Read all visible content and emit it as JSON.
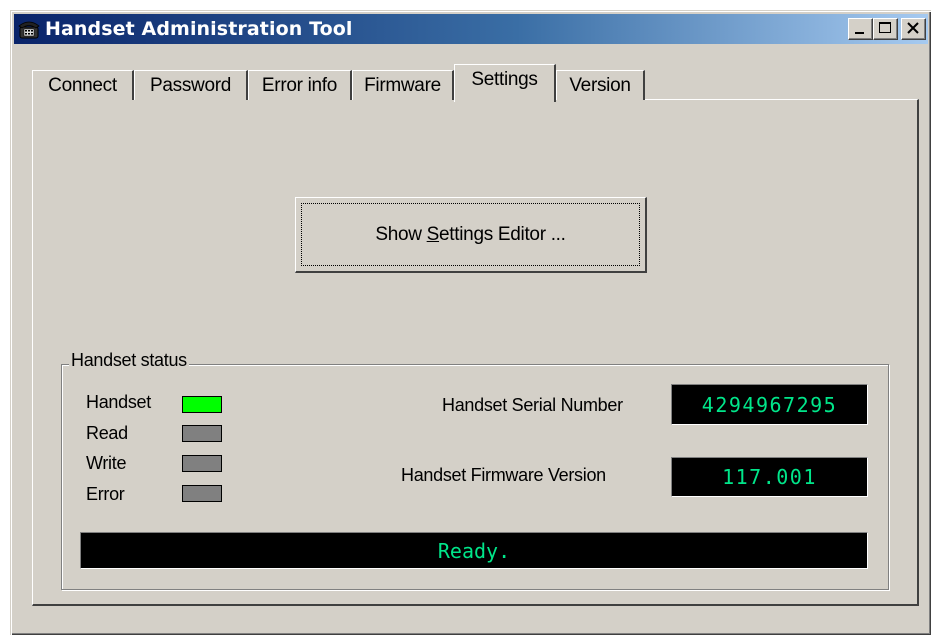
{
  "window": {
    "title": "Handset Administration Tool",
    "icon": "phone-icon",
    "controls": [
      "minimize-icon",
      "maximize-icon",
      "close-icon"
    ]
  },
  "tabs": [
    {
      "label": "Connect",
      "active": false
    },
    {
      "label": "Password",
      "active": false
    },
    {
      "label": "Error info",
      "active": false
    },
    {
      "label": "Firmware",
      "active": false
    },
    {
      "label": "Settings",
      "active": true
    },
    {
      "label": "Version",
      "active": false
    }
  ],
  "settings": {
    "editor_button_prefix": "Show ",
    "editor_button_mnemonic": "S",
    "editor_button_suffix": "ettings Editor ..."
  },
  "status": {
    "group_title": "Handset status",
    "indicators": [
      {
        "label": "Handset",
        "state": "on",
        "color": "#00ff00"
      },
      {
        "label": "Read",
        "state": "off",
        "color": "#808080"
      },
      {
        "label": "Write",
        "state": "off",
        "color": "#808080"
      },
      {
        "label": "Error",
        "state": "off",
        "color": "#808080"
      }
    ],
    "serial_label": "Handset Serial Number",
    "serial_value": "4294967295",
    "firmware_label": "Handset Firmware Version",
    "firmware_value": "117.001",
    "message": "Ready."
  },
  "colors": {
    "lcd_text": "#00e68a",
    "lcd_background": "#000000",
    "title_gradient_start": "#0a246a"
  }
}
